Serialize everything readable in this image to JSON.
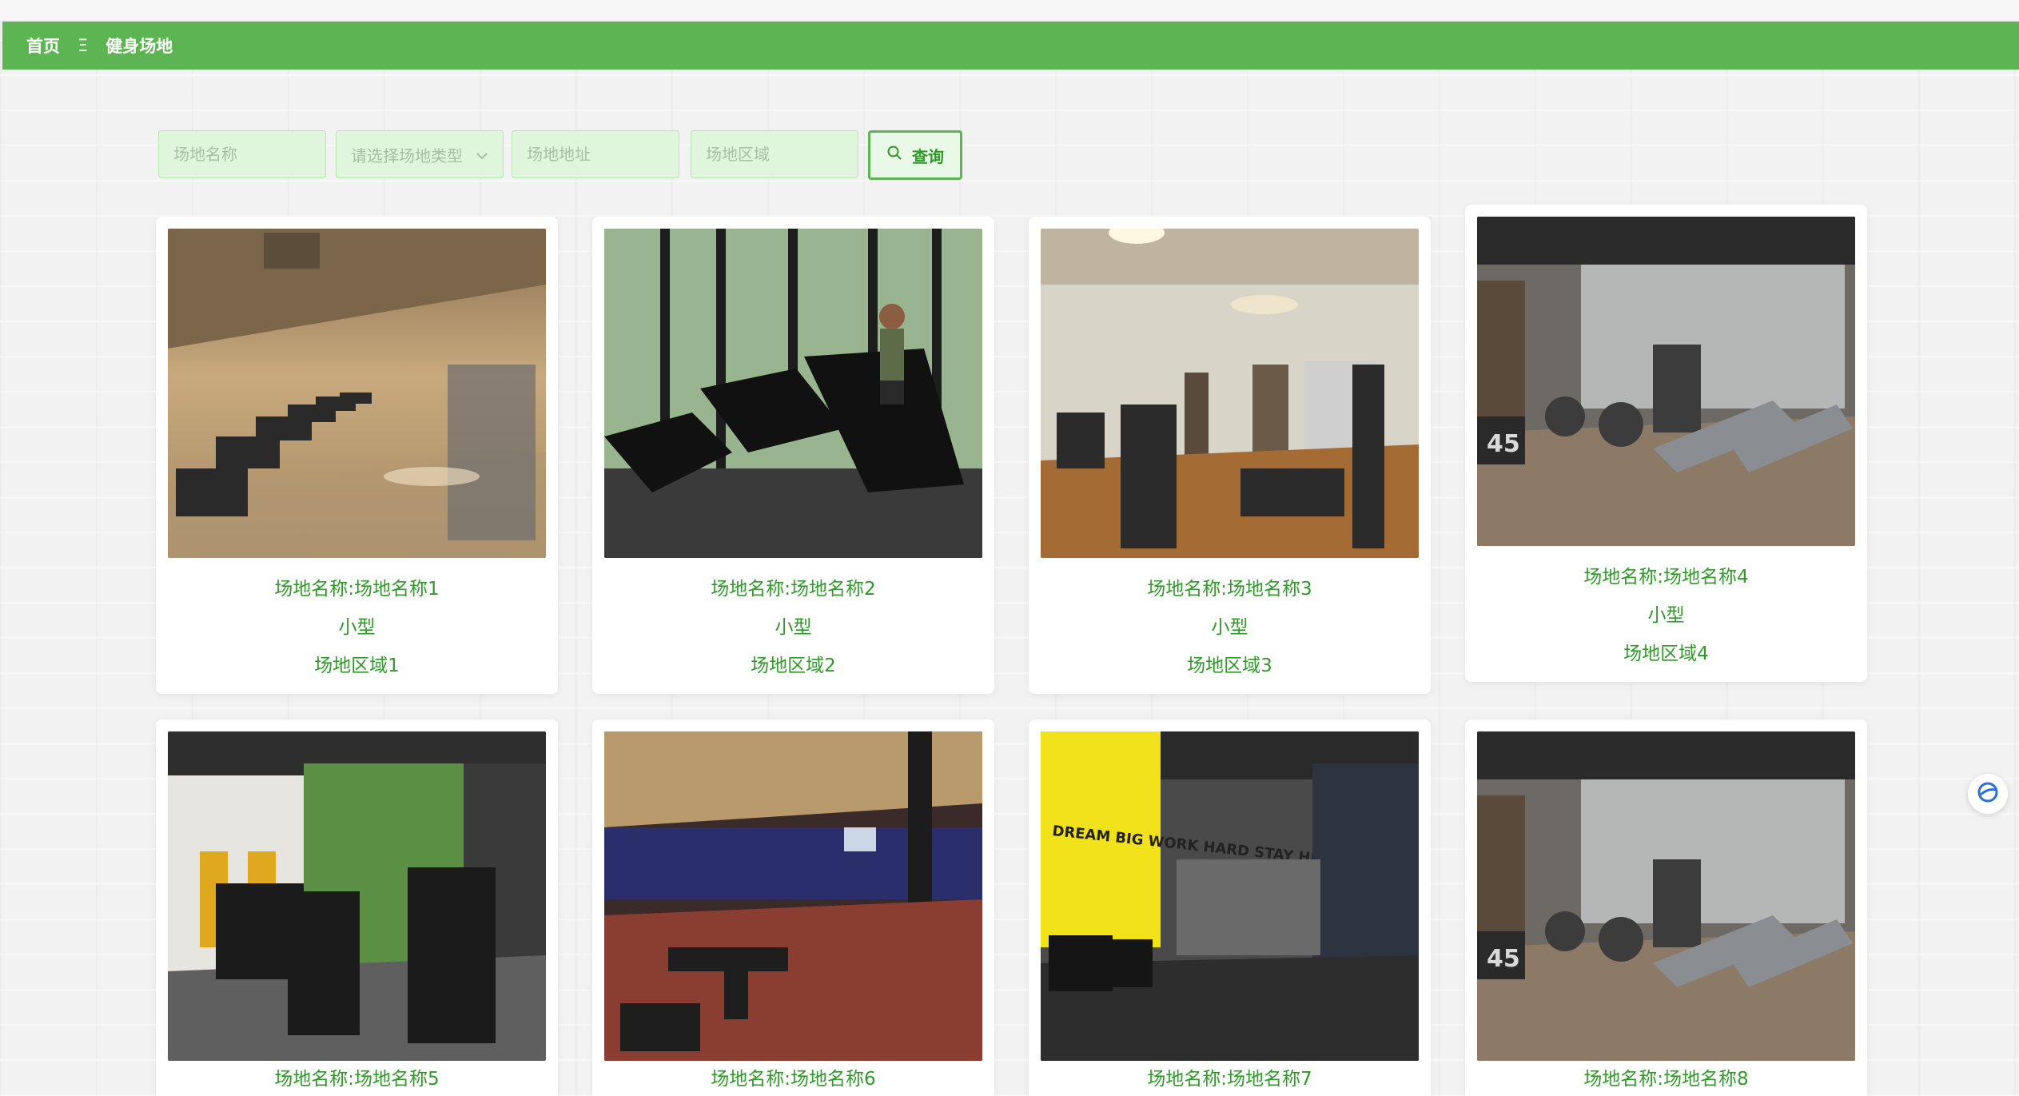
{
  "nav": {
    "home": "首页",
    "sep": "Ξ",
    "current": "健身场地"
  },
  "search": {
    "name_placeholder": "场地名称",
    "type_placeholder": "请选择场地类型",
    "address_placeholder": "场地地址",
    "area_placeholder": "场地区域",
    "button_label": "查询",
    "button_icon": "search-icon"
  },
  "venues": [
    {
      "name": "场地名称:场地名称1",
      "type": "小型",
      "area": "场地区域1"
    },
    {
      "name": "场地名称:场地名称2",
      "type": "小型",
      "area": "场地区域2"
    },
    {
      "name": "场地名称:场地名称3",
      "type": "小型",
      "area": "场地区域3"
    },
    {
      "name": "场地名称:场地名称4",
      "type": "小型",
      "area": "场地区域4"
    },
    {
      "name": "场地名称:场地名称5"
    },
    {
      "name": "场地名称:场地名称6"
    },
    {
      "name": "场地名称:场地名称7"
    },
    {
      "name": "场地名称:场地名称8"
    }
  ],
  "photo_art": {
    "wall_text": "DREAM BIG WORK HARD STAY HUMBLE",
    "plate_number": "45"
  },
  "colors": {
    "primary_green": "#5cb552",
    "text_green": "#2f9a28"
  }
}
